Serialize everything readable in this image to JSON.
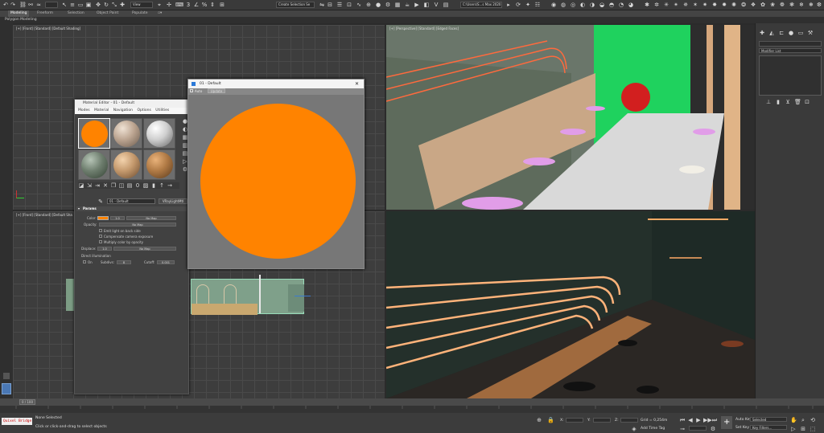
{
  "toolbar": {
    "view_dropdown": "View",
    "selection_set": "Create Selection Se",
    "workspace_path": "C:\\Users\\S...s Max 2020"
  },
  "ribbon": {
    "tabs": [
      "Modeling",
      "Freeform",
      "Selection",
      "Object Paint",
      "Populate"
    ],
    "active_tab": "Modeling",
    "sub_label": "Polygon Modeling"
  },
  "viewports": {
    "top_left_label": "[+] [Front] [Standard] [Default Shading]",
    "top_right_label": "[+] [Perspective] [Standard] [Edged Faces]",
    "bottom_left_label": "[+] [Front] [Standard] [Default Sha"
  },
  "material_editor": {
    "title": "Material Editor - 01 - Default",
    "menu": [
      "Modes",
      "Material",
      "Navigation",
      "Options",
      "Utilities"
    ],
    "slot_colors": [
      "#ff8300",
      "#bca591",
      "#cfcfcf",
      "#6f7f6f",
      "#c4996d",
      "#b07a45"
    ],
    "material_name": "01 - Default",
    "material_type": "VRayLightMtl",
    "rollout_title": "Params",
    "color_label": "Color:",
    "color_value": "1.0",
    "color_map": "No Map",
    "opacity_label": "Opacity:",
    "opacity_map": "No Map",
    "check_emit_back": "Emit light on back side",
    "check_comp_camera": "Compensate camera exposure",
    "check_multiply": "Multiply color by opacity",
    "displace_label": "Displace:",
    "displace_value": "1.0",
    "displace_map": "No Map",
    "direct_illum_label": "Direct illumination",
    "on_label": "On",
    "subdivs_label": "Subdivs:",
    "subdivs_value": "8",
    "cutoff_label": "Cutoff:",
    "cutoff_value": "0.001",
    "accent_color": "#ff8300"
  },
  "preview": {
    "title": "01 - Default",
    "auto_label": "Auto",
    "update_label": "Update",
    "ball_color": "#ff8300"
  },
  "command_panel": {
    "modifier_list": "Modifier List"
  },
  "timeline": {
    "frame_readout": "0 / 100"
  },
  "status": {
    "script_label": "Quixel Bridge",
    "selection_status": "None Selected",
    "hint": "Click or click-and-drag to select objects",
    "x_label": "X:",
    "y_label": "Y:",
    "z_label": "Z:",
    "grid_label": "Grid = 0,254m",
    "add_time_tag": "Add Time Tag",
    "auto_key": "Auto Key",
    "set_key": "Set Key",
    "selected_option": "Selected",
    "key_filters": "Key Filters..."
  }
}
